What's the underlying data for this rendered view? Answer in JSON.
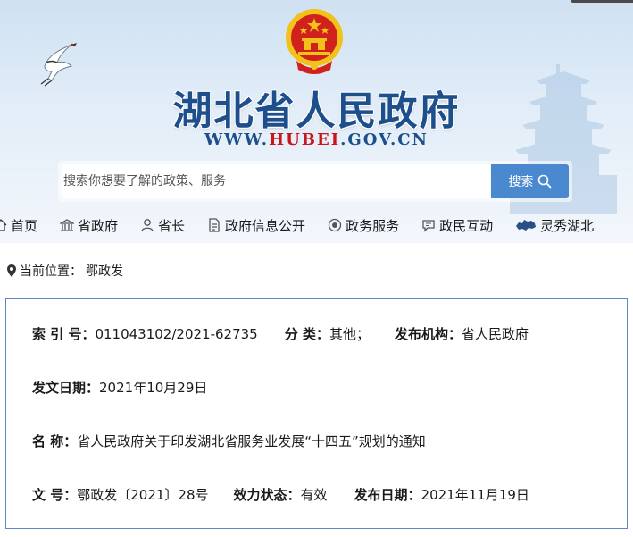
{
  "site": {
    "title": "湖北省人民政府",
    "url_prefix": "WWW.",
    "url_brand": "HUBEI",
    "url_suffix": ".GOV.CN",
    "brand_color": "#1d4f8c",
    "accent_color": "#c8161d"
  },
  "search": {
    "placeholder": "搜索你想要了解的政策、服务",
    "button_label": "搜索",
    "button_icon": "search-icon",
    "button_color": "#4a88d0"
  },
  "nav": {
    "items": [
      {
        "label": "首页",
        "icon": "home-icon"
      },
      {
        "label": "省政府",
        "icon": "building-icon"
      },
      {
        "label": "省长",
        "icon": "person-icon"
      },
      {
        "label": "政府信息公开",
        "icon": "document-icon"
      },
      {
        "label": "政务服务",
        "icon": "service-icon"
      },
      {
        "label": "政民互动",
        "icon": "chat-icon"
      },
      {
        "label": "灵秀湖北",
        "icon": "hubei-map-icon"
      }
    ]
  },
  "breadcrumb": {
    "icon": "location-pin-icon",
    "prefix": "当前位置：",
    "current": "鄂政发"
  },
  "document": {
    "index_label": "索 引 号：",
    "index_value": "011043102/2021-62735",
    "category_label": "分 类：",
    "category_value": "其他；",
    "publisher_label": "发布机构：",
    "publisher_value": "省人民政府",
    "issue_date_label": "发文日期：",
    "issue_date_value": "2021年10月29日",
    "name_label": "名 称：",
    "name_value": "省人民政府关于印发湖北省服务业发展“十四五”规划的通知",
    "doc_no_label": "文 号：",
    "doc_no_value": "鄂政发〔2021〕28号",
    "status_label": "效力状态：",
    "status_value": "有效",
    "publish_date_label": "发布日期：",
    "publish_date_value": "2021年11月19日",
    "border_color": "#5b89c5"
  }
}
